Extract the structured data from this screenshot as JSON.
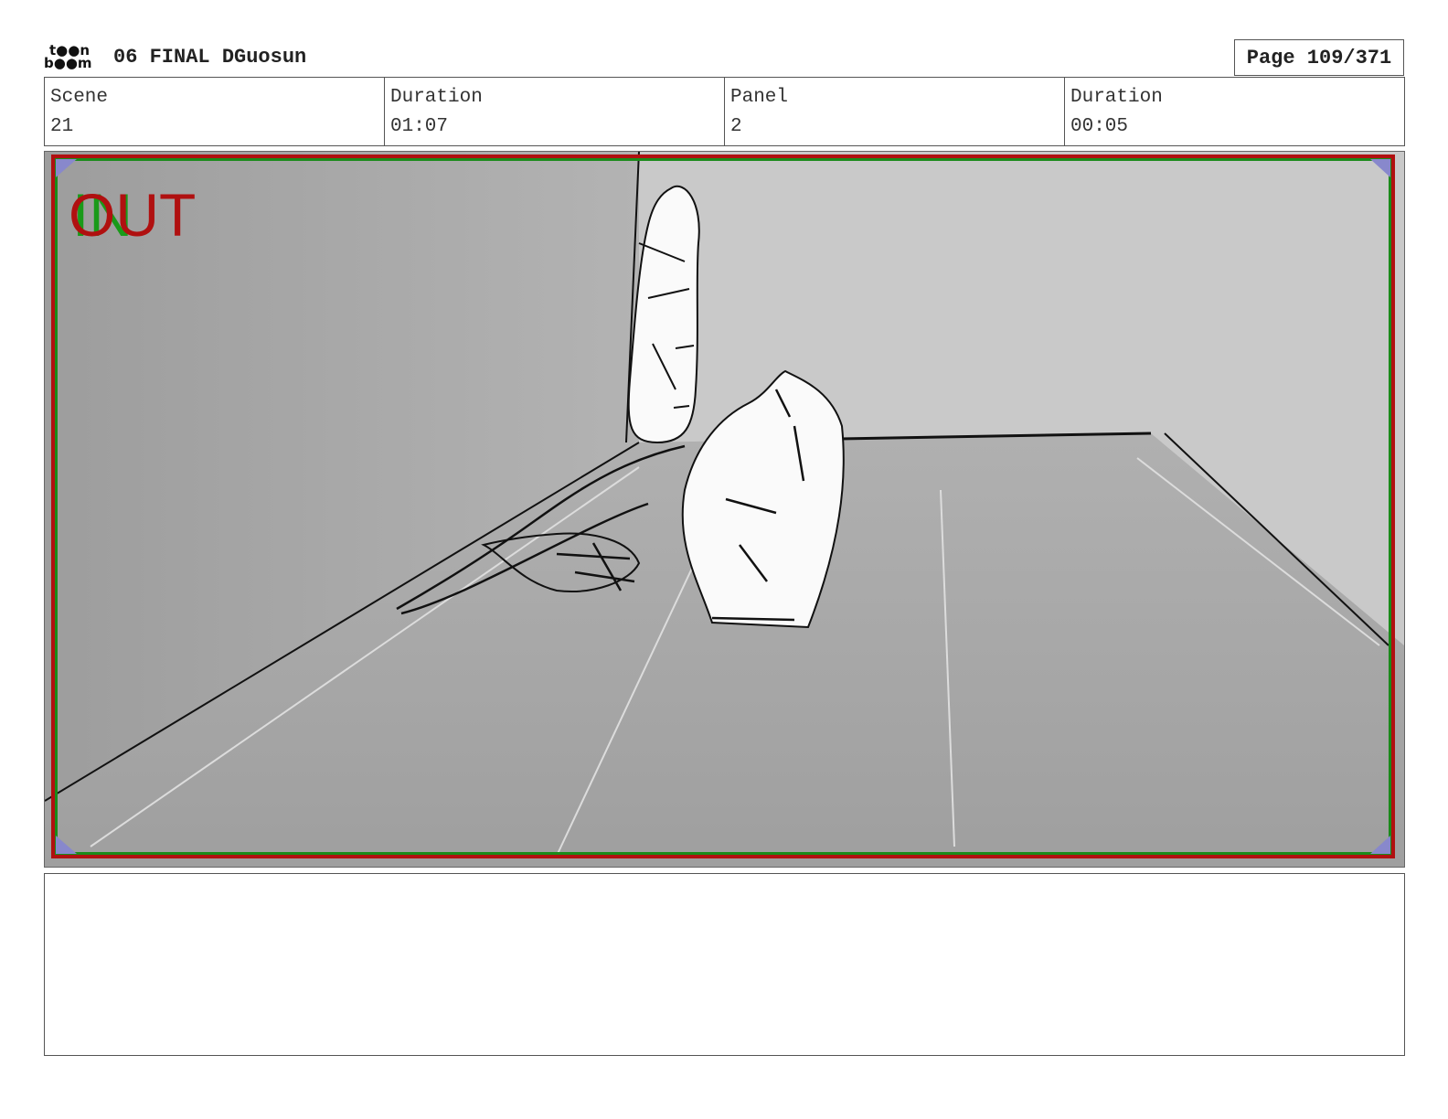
{
  "header": {
    "logo_line1": "t●●n",
    "logo_line2": "b●●m",
    "title": "06 FINAL DGuosun",
    "page": "Page 109/371"
  },
  "info": {
    "scene_label": "Scene",
    "scene_value": "21",
    "scene_duration_label": "Duration",
    "scene_duration_value": "01:07",
    "panel_label": "Panel",
    "panel_value": "2",
    "panel_duration_label": "Duration",
    "panel_duration_value": "00:05"
  },
  "panel": {
    "overlay_in": "IN",
    "overlay_out": "OUT",
    "frame_color_out": "#b01010",
    "frame_color_in": "#1a8a1a"
  },
  "notes": {
    "text": ""
  }
}
